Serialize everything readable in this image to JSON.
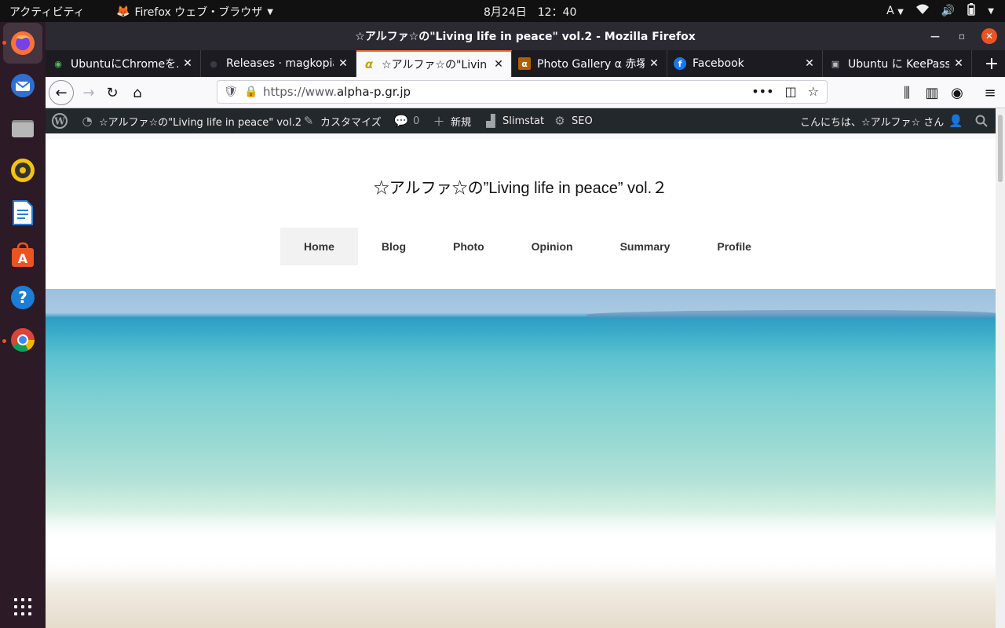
{
  "top_panel": {
    "activities": "アクティビティ",
    "app_menu": "Firefox ウェブ・ブラウザ",
    "clock": "8月24日　12：40",
    "input_method": "A"
  },
  "dock": {
    "icons": [
      "firefox-icon",
      "thunderbird-icon",
      "files-icon",
      "rhythmbox-icon",
      "libreoffice-writer-icon",
      "software-center-icon",
      "help-icon",
      "chrome-icon",
      "show-apps-icon"
    ]
  },
  "window": {
    "title": "☆アルファ☆の\"Living life in peace\" vol.2 - Mozilla Firefox"
  },
  "tabs": [
    {
      "label": "UbuntuにChromeを…",
      "favicon": "◉",
      "favicon_color": "#5cb85c"
    },
    {
      "label": "Releases · magkopian",
      "favicon": "●",
      "favicon_color": "#24292e"
    },
    {
      "label": "☆アルファ☆の\"Livin",
      "favicon": "α",
      "favicon_color": "#c8a200"
    },
    {
      "label": "Photo Gallery α 赤塚",
      "favicon": "α",
      "favicon_color": "#b06000"
    },
    {
      "label": "Facebook",
      "favicon": "f",
      "favicon_color": "#1877f2"
    },
    {
      "label": "Ubuntu に KeePassX",
      "favicon": "▣",
      "favicon_color": "#777777"
    }
  ],
  "navbar": {
    "url_prefix": "https://www.",
    "url_domain": "alpha-p.gr.jp"
  },
  "admin_bar": {
    "site_name": "☆アルファ☆の\"Living life in peace\" vol.2",
    "customize": "カスタマイズ",
    "comments": "0",
    "new": "新規",
    "slimstat": "Slimstat",
    "seo": "SEO",
    "greeting": "こんにちは、☆アルファ☆ さん"
  },
  "site": {
    "title": "☆アルファ☆の”Living life in peace” vol.２",
    "menu": [
      "Home",
      "Blog",
      "Photo",
      "Opinion",
      "Summary",
      "Profile"
    ],
    "current_menu": "Home"
  },
  "colors": {
    "accent": "#e95420",
    "tab_highlight": "#ff6a2f",
    "admin_bar": "#23282d"
  }
}
